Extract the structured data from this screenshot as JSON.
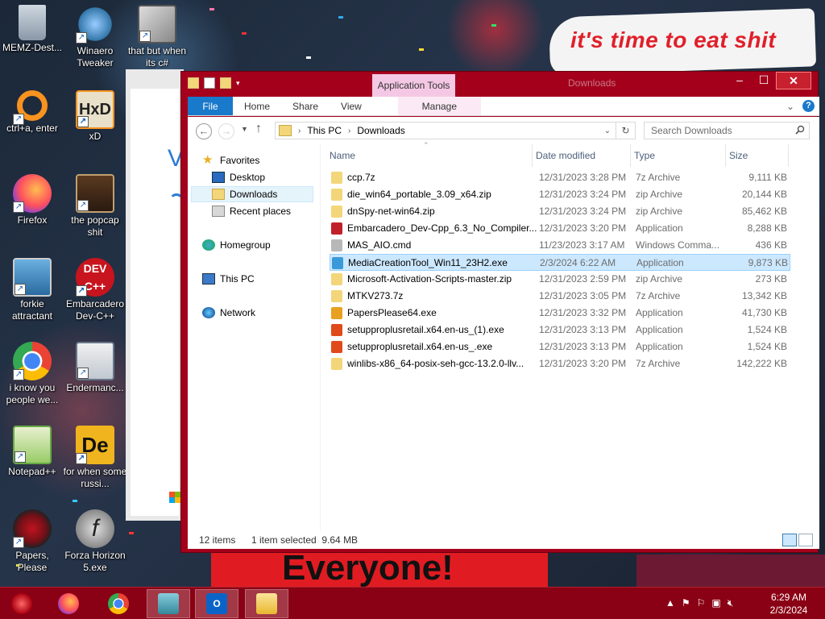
{
  "wallpaper": {
    "sign_text": "it's time to eat shit",
    "banner_text": "Everyone!"
  },
  "desktop_icons": [
    {
      "label": "MEMZ-Dest...",
      "icon": "recycle-bin-icon"
    },
    {
      "label": "Winaero Tweaker",
      "icon": "winaero-icon"
    },
    {
      "label": "that but when its c#",
      "icon": "stack-windows-icon"
    },
    {
      "label": "ctrl+a, enter",
      "icon": "ring-icon"
    },
    {
      "label": "xD",
      "icon": "hxd-icon"
    },
    {
      "label": "Firefox",
      "icon": "firefox-icon"
    },
    {
      "label": "the popcap shit",
      "icon": "popcap-icon"
    },
    {
      "label": "forkie attractant",
      "icon": "gear-monitor-icon"
    },
    {
      "label": "Embarcadero Dev-C++",
      "icon": "devcpp-icon"
    },
    {
      "label": "i know you people we...",
      "icon": "chrome-icon"
    },
    {
      "label": "Endermanc...",
      "icon": "window-app-icon"
    },
    {
      "label": "Notepad++",
      "icon": "notepadpp-icon"
    },
    {
      "label": "for when some russi...",
      "icon": "de-icon"
    },
    {
      "label": "Papers, Please",
      "icon": "papers-please-icon"
    },
    {
      "label": "Forza Horizon 5.exe",
      "icon": "flash-icon"
    }
  ],
  "background_window": {
    "text": "Ve"
  },
  "explorer": {
    "title": "Downloads",
    "app_tools": "Application Tools",
    "tabs": {
      "file": "File",
      "home": "Home",
      "share": "Share",
      "view": "View",
      "manage": "Manage"
    },
    "address": {
      "segments": [
        "This PC",
        "Downloads"
      ]
    },
    "search_placeholder": "Search Downloads",
    "nav": {
      "favorites": "Favorites",
      "desktop": "Desktop",
      "downloads": "Downloads",
      "recent": "Recent places",
      "homegroup": "Homegroup",
      "thispc": "This PC",
      "network": "Network"
    },
    "columns": {
      "name": "Name",
      "date": "Date modified",
      "type": "Type",
      "size": "Size"
    },
    "files": [
      {
        "name": "ccp.7z",
        "date": "12/31/2023 3:28 PM",
        "type": "7z Archive",
        "size": "9,111 KB",
        "icon_color": "#f3d679"
      },
      {
        "name": "die_win64_portable_3.09_x64.zip",
        "date": "12/31/2023 3:24 PM",
        "type": "zip Archive",
        "size": "20,144 KB",
        "icon_color": "#f3d679"
      },
      {
        "name": "dnSpy-net-win64.zip",
        "date": "12/31/2023 3:24 PM",
        "type": "zip Archive",
        "size": "85,462 KB",
        "icon_color": "#f3d679"
      },
      {
        "name": "Embarcadero_Dev-Cpp_6.3_No_Compiler...",
        "date": "12/31/2023 3:20 PM",
        "type": "Application",
        "size": "8,288 KB",
        "icon_color": "#c0202a"
      },
      {
        "name": "MAS_AIO.cmd",
        "date": "11/23/2023 3:17 AM",
        "type": "Windows Comma...",
        "size": "436 KB",
        "icon_color": "#b8b8b8"
      },
      {
        "name": "MediaCreationTool_Win11_23H2.exe",
        "date": "2/3/2024 6:22 AM",
        "type": "Application",
        "size": "9,873 KB",
        "icon_color": "#3a9ad9"
      },
      {
        "name": "Microsoft-Activation-Scripts-master.zip",
        "date": "12/31/2023 2:59 PM",
        "type": "zip Archive",
        "size": "273 KB",
        "icon_color": "#f3d679"
      },
      {
        "name": "MTKV273.7z",
        "date": "12/31/2023 3:05 PM",
        "type": "7z Archive",
        "size": "13,342 KB",
        "icon_color": "#f3d679"
      },
      {
        "name": "PapersPlease64.exe",
        "date": "12/31/2023 3:32 PM",
        "type": "Application",
        "size": "41,730 KB",
        "icon_color": "#e8a020"
      },
      {
        "name": "setupproplusretail.x64.en-us_(1).exe",
        "date": "12/31/2023 3:13 PM",
        "type": "Application",
        "size": "1,524 KB",
        "icon_color": "#e04a1a"
      },
      {
        "name": "setupproplusretail.x64.en-us_.exe",
        "date": "12/31/2023 3:13 PM",
        "type": "Application",
        "size": "1,524 KB",
        "icon_color": "#e04a1a"
      },
      {
        "name": "winlibs-x86_64-posix-seh-gcc-13.2.0-llv...",
        "date": "12/31/2023 3:20 PM",
        "type": "7z Archive",
        "size": "142,222 KB",
        "icon_color": "#f3d679"
      }
    ],
    "selected_index": 5,
    "status": {
      "items": "12 items",
      "selected": "1 item selected  9.64 MB"
    }
  },
  "taskbar": {
    "clock_time": "6:29 AM",
    "clock_date": "2/3/2024"
  }
}
